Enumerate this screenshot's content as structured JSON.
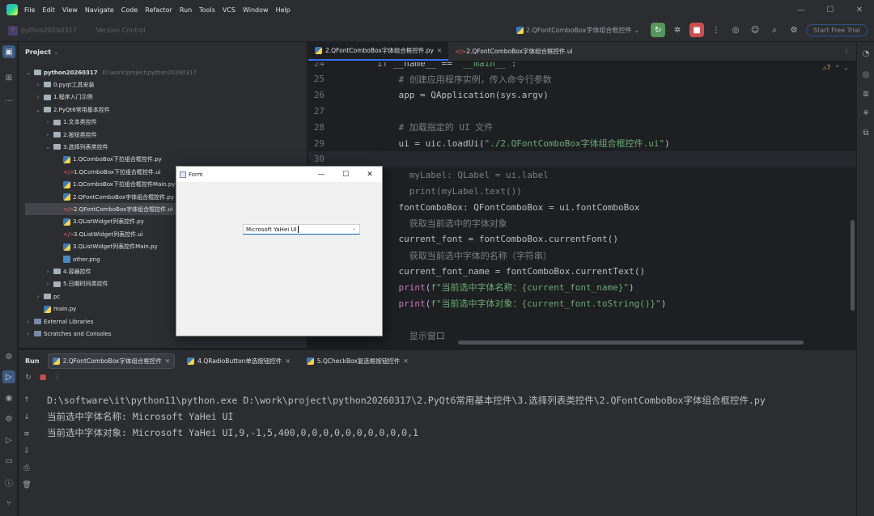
{
  "menubar": {
    "items": [
      "File",
      "Edit",
      "View",
      "Navigate",
      "Code",
      "Refactor",
      "Run",
      "Tools",
      "VCS",
      "Window",
      "Help"
    ]
  },
  "toolbar": {
    "project_name": "python20260317",
    "vcs_label": "Version Control",
    "run_config": "2.QFontComboBox字体组合框控件",
    "trial_label": "Start Free Trial"
  },
  "project": {
    "header": "Project",
    "tree": [
      {
        "label": "python20260317",
        "hint": "D:\\work\\project\\python20260317",
        "depth": 0,
        "type": "folder",
        "expanded": true
      },
      {
        "label": "0.pyqt工具安装",
        "depth": 1,
        "type": "folder",
        "expanded": false
      },
      {
        "label": "1.程序入门示例",
        "depth": 1,
        "type": "folder",
        "expanded": false
      },
      {
        "label": "2.PyQt6常用基本控件",
        "depth": 1,
        "type": "folder",
        "expanded": true
      },
      {
        "label": "1.文本类控件",
        "depth": 2,
        "type": "folder",
        "expanded": false
      },
      {
        "label": "2.按钮类控件",
        "depth": 2,
        "type": "folder",
        "expanded": false
      },
      {
        "label": "3.选择列表类控件",
        "depth": 2,
        "type": "folder",
        "expanded": true
      },
      {
        "label": "1.QComboBox下拉组合框控件.py",
        "depth": 3,
        "type": "py"
      },
      {
        "label": "1.QComboBox下拉组合框控件.ui",
        "depth": 3,
        "type": "ui"
      },
      {
        "label": "1.QComboBox下拉组合框控件Main.py",
        "depth": 3,
        "type": "py"
      },
      {
        "label": "2.QFontComboBox字体组合框控件.py",
        "depth": 3,
        "type": "py"
      },
      {
        "label": "2.QFontComboBox字体组合框控件.ui",
        "depth": 3,
        "type": "ui",
        "selected": true
      },
      {
        "label": "3.QListWidget列表控件.py",
        "depth": 3,
        "type": "py"
      },
      {
        "label": "3.QListWidget列表控件.ui",
        "depth": 3,
        "type": "ui"
      },
      {
        "label": "3.QListWidget列表控件Main.py",
        "depth": 3,
        "type": "py"
      },
      {
        "label": "other.png",
        "depth": 3,
        "type": "png"
      },
      {
        "label": "4.容器控件",
        "depth": 2,
        "type": "folder",
        "expanded": false
      },
      {
        "label": "5.日期时间类控件",
        "depth": 2,
        "type": "folder",
        "expanded": false
      },
      {
        "label": "pc",
        "depth": 1,
        "type": "folder",
        "expanded": false
      },
      {
        "label": "main.py",
        "depth": 1,
        "type": "py"
      },
      {
        "label": "External Libraries",
        "depth": 0,
        "type": "lib",
        "expanded": false
      },
      {
        "label": "Scratches and Consoles",
        "depth": 0,
        "type": "lib",
        "expanded": false
      }
    ]
  },
  "editor": {
    "tabs": [
      {
        "label": "2.QFontComboBox字体组合框控件.py",
        "active": true
      },
      {
        "label": "2.QFontComboBox字体组合框控件.ui",
        "active": false
      }
    ],
    "inspection": "⚠7",
    "lines": [
      {
        "n": "24",
        "text": "if __name__ == '__main__':",
        "cls": ""
      },
      {
        "n": "25",
        "text": "    # 创建应用程序实例，传入命令行参数",
        "cls": "cmt"
      },
      {
        "n": "26",
        "text": "    app = QApplication(sys.argv)",
        "cls": ""
      },
      {
        "n": "27",
        "text": "",
        "cls": ""
      },
      {
        "n": "28",
        "text": "    # 加载指定的 UI 文件",
        "cls": "cmt"
      },
      {
        "n": "29",
        "text": "    ui = uic.loadUi(\"./2.QFontComboBox字体组合框控件.ui\")",
        "cls": ""
      },
      {
        "n": "30",
        "text": "",
        "cls": ""
      },
      {
        "n": "",
        "text": "      myLabel: QLabel = ui.label",
        "cls": "cmt"
      },
      {
        "n": "",
        "text": "      print(myLabel.text())",
        "cls": "cmt"
      },
      {
        "n": "",
        "text": "    fontComboBox: QFontComboBox = ui.fontComboBox",
        "cls": ""
      },
      {
        "n": "",
        "text": "      获取当前选中的字体对象",
        "cls": "cmt"
      },
      {
        "n": "",
        "text": "    current_font = fontComboBox.currentFont()",
        "cls": ""
      },
      {
        "n": "",
        "text": "      获取当前选中字体的名称（字符串）",
        "cls": "cmt"
      },
      {
        "n": "",
        "text": "    current_font_name = fontComboBox.currentText()",
        "cls": ""
      },
      {
        "n": "",
        "text": "    print(f\"当前选中字体名称：{current_font_name}\")",
        "cls": ""
      },
      {
        "n": "",
        "text": "    print(f\"当前选中字体对象：{current_font.toString()}\")",
        "cls": ""
      },
      {
        "n": "",
        "text": "",
        "cls": ""
      },
      {
        "n": "",
        "text": "      显示窗口",
        "cls": "cmt"
      }
    ]
  },
  "run": {
    "title": "Run",
    "tabs": [
      {
        "label": "2.QFontComboBox字体组合框控件",
        "active": true
      },
      {
        "label": "4.QRadioButton单选按钮控件",
        "active": false
      },
      {
        "label": "5.QCheckBox复选框按钮控件",
        "active": false
      }
    ],
    "console": [
      "D:\\software\\it\\python11\\python.exe D:\\work\\project\\python20260317\\2.PyQt6常用基本控件\\3.选择列表类控件\\2.QFontComboBox字体组合框控件.py",
      "当前选中字体名称: Microsoft YaHei UI",
      "当前选中字体对象: Microsoft YaHei UI,9,-1,5,400,0,0,0,0,0,0,0,0,0,0,1"
    ]
  },
  "form": {
    "title": "Form",
    "combo_value": "Microsoft YaHei UI"
  },
  "colors": {
    "accent": "#3574f0",
    "run_green": "#57965c",
    "stop_red": "#c94f4f"
  }
}
